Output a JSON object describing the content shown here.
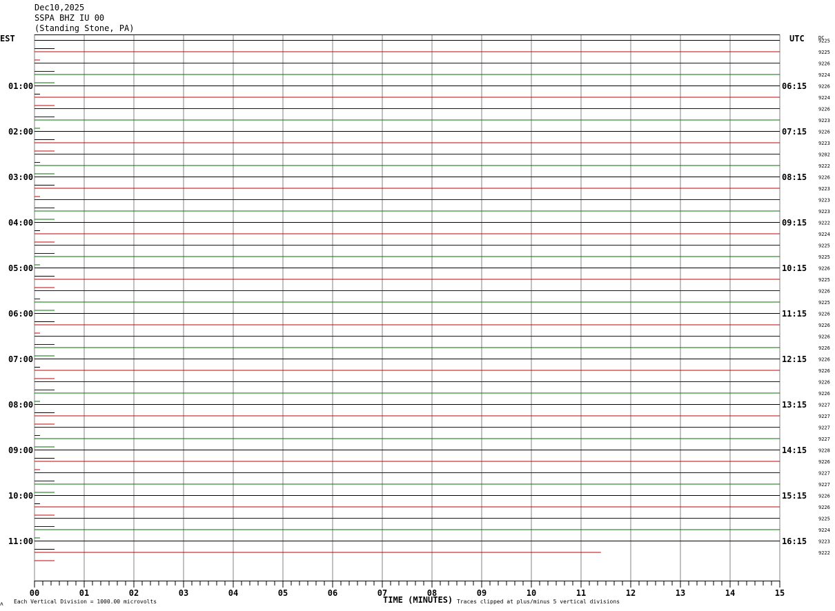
{
  "header": {
    "date": "Dec10,2025",
    "station": "SSPA BHZ IU 00",
    "location": "(Standing Stone, PA)"
  },
  "axes": {
    "left_tz": "EST",
    "right_tz": "UTC",
    "dc_label": "DC",
    "xlabel": "TIME (MINUTES)",
    "footer_left": "Each Vertical Division = 1000.00 microvolts",
    "footer_right": "Traces clipped at plus/minus 5 vertical divisions",
    "corner_mark": "ʌ"
  },
  "colors": {
    "trace_cycle": [
      "#000000",
      "#c00000",
      "#0000c0",
      "#007000"
    ],
    "grid": "#808080"
  },
  "chart_data": {
    "type": "line",
    "xlabel": "TIME (MINUTES)",
    "x_ticks": [
      "00",
      "01",
      "02",
      "03",
      "04",
      "05",
      "06",
      "07",
      "08",
      "09",
      "10",
      "11",
      "12",
      "13",
      "14",
      "15"
    ],
    "xlim": [
      0,
      15
    ],
    "minutes_per_line": 15,
    "last_trace_end_minute": 11.4,
    "grid": true,
    "left_hour_labels": [
      "01:00",
      "02:00",
      "03:00",
      "04:00",
      "05:00",
      "06:00",
      "07:00",
      "08:00",
      "09:00",
      "10:00",
      "11:00"
    ],
    "right_hour_labels": [
      "06:15",
      "07:15",
      "08:15",
      "09:15",
      "10:15",
      "11:15",
      "12:15",
      "13:15",
      "14:15",
      "15:15",
      "16:15"
    ],
    "dc_values": [
      "9225",
      "9225",
      "9226",
      "9224",
      "9226",
      "9224",
      "9226",
      "9223",
      "9226",
      "9223",
      "9202",
      "9222",
      "9226",
      "9223",
      "9223",
      "9223",
      "9222",
      "9224",
      "9225",
      "9225",
      "9226",
      "9225",
      "9226",
      "9225",
      "9226",
      "9226",
      "9226",
      "9226",
      "9226",
      "9226",
      "9226",
      "9226",
      "9227",
      "9227",
      "9227",
      "9227",
      "9228",
      "9226",
      "9227",
      "9227",
      "9226",
      "9226",
      "9225",
      "9224",
      "9223",
      "9222"
    ]
  }
}
